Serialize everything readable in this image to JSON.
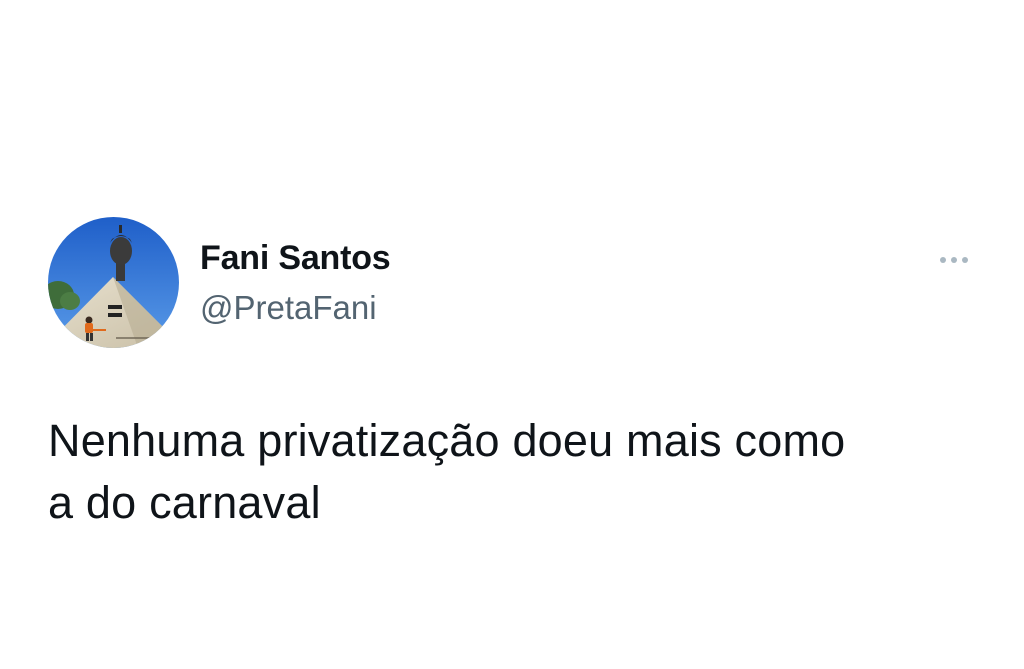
{
  "author": {
    "display_name": "Fani Santos",
    "handle": "@PretaFani",
    "avatar_icon": "statue-bust-avatar"
  },
  "tweet": {
    "text_lines": [
      "Nenhuma privatização doeu mais como",
      "a do carnaval"
    ]
  },
  "menu": {
    "icon": "more-options-icon"
  },
  "colors": {
    "text_primary": "#0f1419",
    "text_secondary": "#536471",
    "menu_dots": "#aab8c2",
    "background": "#ffffff"
  }
}
